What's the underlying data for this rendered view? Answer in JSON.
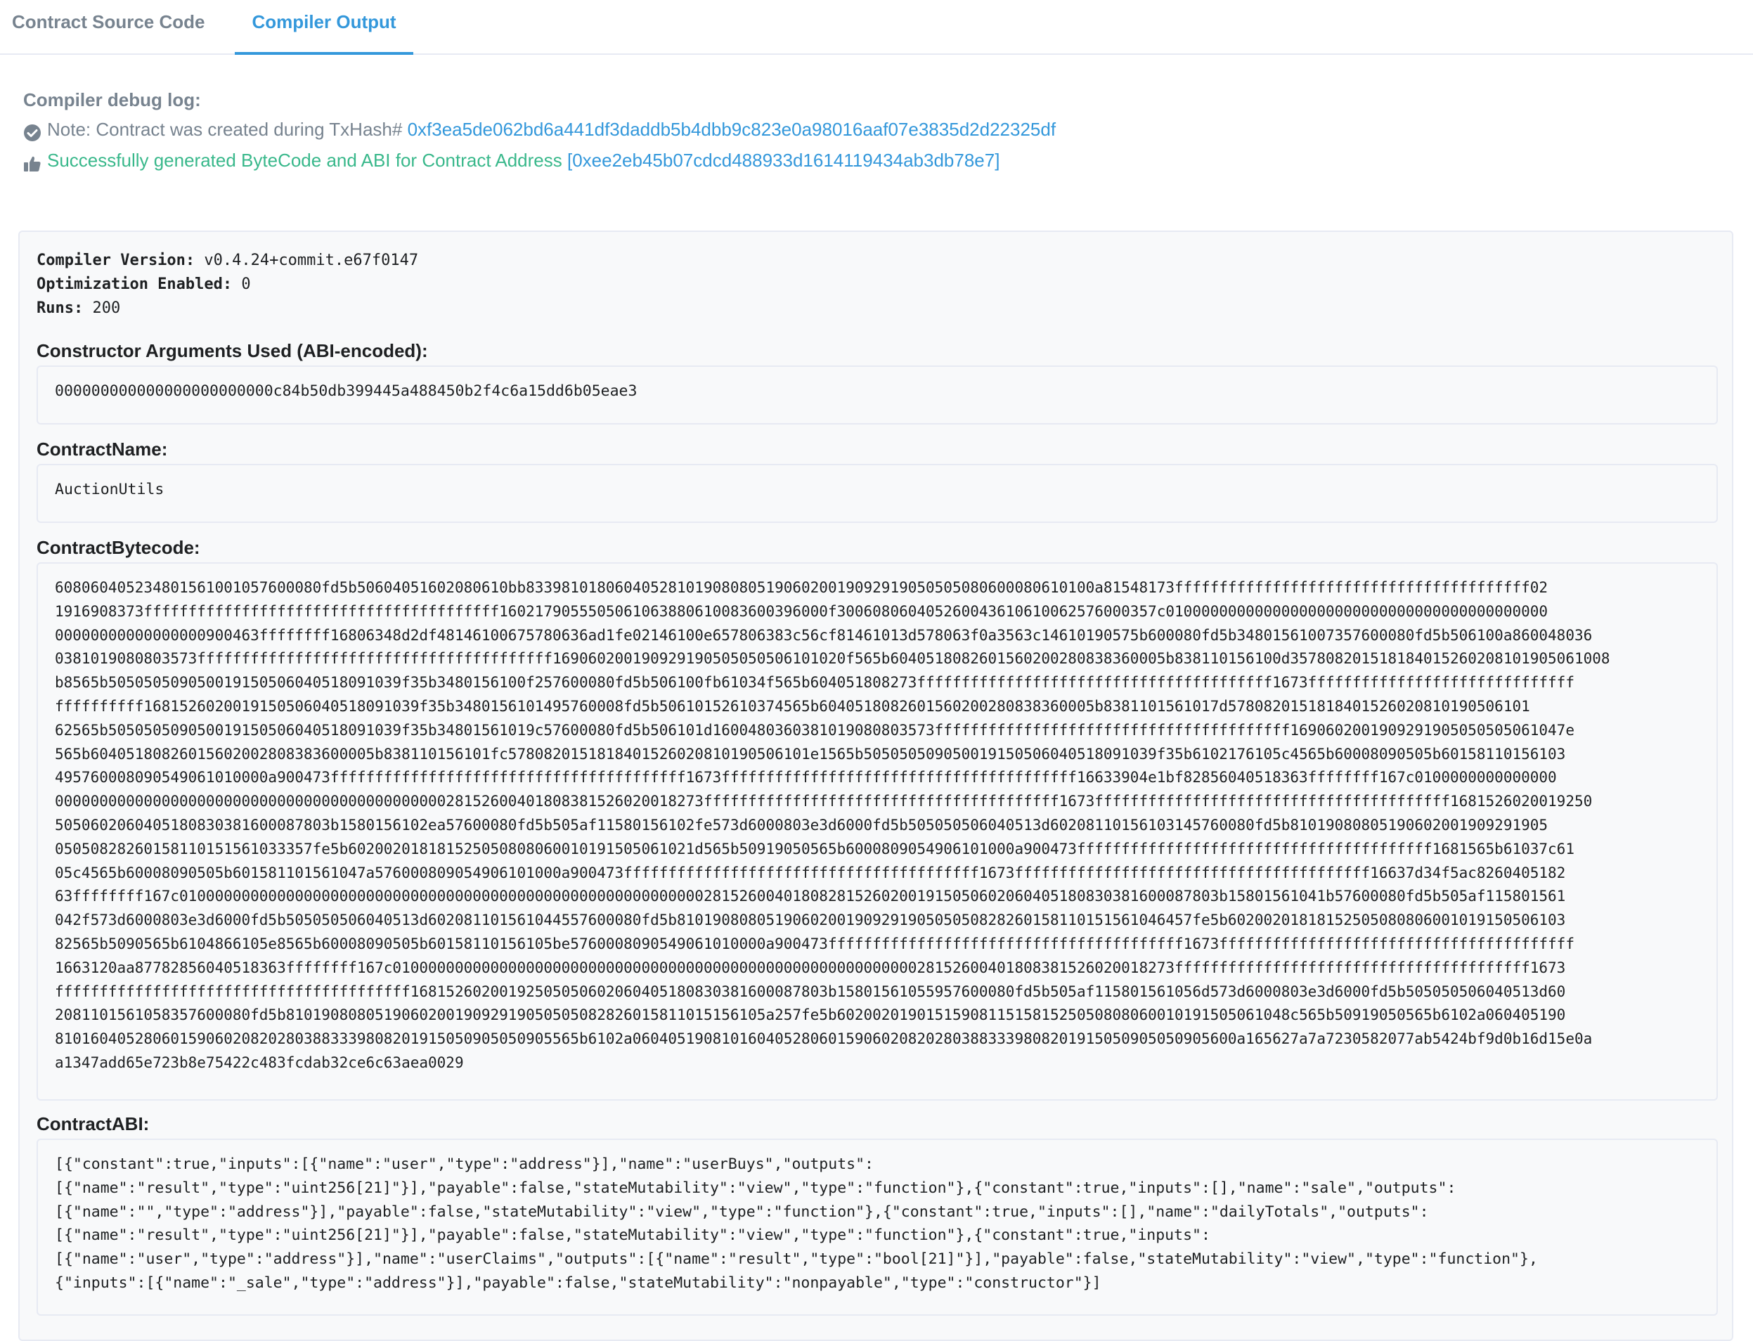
{
  "tabs": [
    {
      "label": "Contract Source Code"
    },
    {
      "label": "Compiler Output"
    }
  ],
  "debug": {
    "heading": "Compiler debug log:",
    "note_label": "Note: Contract was created during TxHash#",
    "tx_hash": "0xf3ea5de062bd6a441df3daddb5b4dbb9c823e0a98016aaf07e3835d2d22325df",
    "success_text": "Successfully generated ByteCode and ABI for Contract Address",
    "contract_address": "[0xee2eb45b07cdcd488933d1614119434ab3db78e7]"
  },
  "compiler": {
    "version_label": "Compiler Version:",
    "version_value": "v0.4.24+commit.e67f0147",
    "optimization_label": "Optimization Enabled:",
    "optimization_value": "0",
    "runs_label": "Runs:",
    "runs_value": "200"
  },
  "sections": {
    "constructor_title": "Constructor Arguments Used (ABI-encoded):",
    "constructor_value": "000000000000000000000000c84b50db399445a488450b2f4c6a15dd6b05eae3",
    "name_title": "ContractName:",
    "name_value": "AuctionUtils",
    "bytecode_title": "ContractBytecode:",
    "bytecode_lines": [
      "608060405234801561001057600080fd5b50604051602080610bb8339810180604052810190808051906020019092919050505080600080610100a81548173ffffffffffffffffffffffffffffffffffffffff02",
      "1916908373ffffffffffffffffffffffffffffffffffffffff1602179055505061063880610083600396000f300608060405260043610610062576000357c0100000000000000000000000000000000000000000",
      "00000000000000000900463ffffffff16806348d2df48146100675780636ad1fe02146100e657806383c56cf81461013d578063f0a3563c14610190575b600080fd5b34801561007357600080fd5b506100a860048036",
      "0381019080803573ffffffffffffffffffffffffffffffffffffffff169060200190929190505050506101020f565b6040518082601560200280838360005b838110156100d357808201518184015260208101905061008",
      "b8565b505050509050019150506040518091039f35b3480156100f257600080fd5b506100fb61034f565b604051808273ffffffffffffffffffffffffffffffffffffffff1673ffffffffffffffffffffffffffffff",
      "ffffffffff1681526020019150506040518091039f35b3480156101495760008fd5b50610152610374565b6040518082601560200280838360005b8381101561017d5780820151818401526020810190506101",
      "62565b505050509050019150506040518091039f35b34801561019c57600080fd5b506101d160048036038101908080357 3ffffffffffffffffffffffffffffffffffffffff1690602001909291905050505061047e",
      "565b60405180826015602002808383600005b838110156101fc578082015181840152602081019050610 1e1565b505050509050019150506040518091039f35b6102176105c4565b60008090505b601581101561 03",
      "495760008090549061010000a900473ffffffffffffffffffffffffffffffffffffffff1673ffffffffffffffffffffffffffffffffffffffff16633904e1bf82856040518363ffffffff167c0100000000000000",
      "0000000000000000000000000000000000000000000028152600401808381526020018273ffffffffffffffffffffffffffffffffffffffff1673ffffffffffffffffffffffffffffffffffffffff1681526020019250",
      "5050602060405180830381600087803b1580156102ea57600080fd5b505af11580156102fe573d6000803e3d6000fd5b505050506040513d60208110156103145760080fd5b81019080805190602001909291905",
      "05050828260158110151561033357fe5b602002018181525050808060010191505061021d565b50919050565b600080905490610100 0a900473ffffffffffffffffffffffffffffffffffffffff1681565b61037c61",
      "05c4565b60008090505b601581101561047a576000809054906101000a900473ffffffffffffffffffffffffffffffffffffffff1673ffffffffffffffffffffffffffffffffffffffff16637d34f5ac8260405182",
      "63ffffffff167c0100000000000000000000000000000000000000000000000000000000028152600401808281526020019150506020604051808303816000 87803b15801561041b57600080fd5b505af115801561",
      "042f573d6000803e3d6000fd5b505050506040513d602081101561044557600080fd5b810190808051906020019092919050505082826015811015156104 6457fe5b602002018181525050808060010191505061 03",
      "82565b5090565b6104866105e8565b60008090505b60158110156105be5760008090549061010000a900473ffffffffffffffffffffffffffffffffffffffff1673ffffffffffffffffffffffffffffffffffffffff",
      "1663120aa87782856040518363ffffffff167c01000000000000000000000000000000000000000000000000000000000281526004018083815260200182 73ffffffffffffffffffffffffffffffffffffffff1673",
      "ffffffffffffffffffffffffffffffffffffffff16815260200192505050602060405180830381600087803b15801561055957600080fd5b505af115801561056d573d6000803e3d6000fd5b505050506040513d60",
      "20811015610583576000 80fd5b810190808051906020019092919050505082826015811015156105a257fe5b602002019015159081151581525050808060010191505061048c565b50919050565b6102a060405190",
      "81016040528060159060208202803883339808201915050905050905565b6102a06040519081016040528060159060208202803883339808201915050905050905600a165627a7a7230582077ab5424bf9d0b16d15e0a",
      "a1347add65e723b8e75422c483fcdab32ce6c63aea0029"
    ],
    "abi_title": "ContractABI:",
    "abi_lines": [
      "[{\"constant\":true,\"inputs\":[{\"name\":\"user\",\"type\":\"address\"}],\"name\":\"userBuys\",\"outputs\":",
      "[{\"name\":\"result\",\"type\":\"uint256[21]\"}],\"payable\":false,\"stateMutability\":\"view\",\"type\":\"function\"},{\"constant\":true,\"inputs\":[],\"name\":\"sale\",\"outputs\":",
      "[{\"name\":\"\",\"type\":\"address\"}],\"payable\":false,\"stateMutability\":\"view\",\"type\":\"function\"},{\"constant\":true,\"inputs\":[],\"name\":\"dailyTotals\",\"outputs\":",
      "[{\"name\":\"result\",\"type\":\"uint256[21]\"}],\"payable\":false,\"stateMutability\":\"view\",\"type\":\"function\"},{\"constant\":true,\"inputs\":",
      "[{\"name\":\"user\",\"type\":\"address\"}],\"name\":\"userClaims\",\"outputs\":[{\"name\":\"result\",\"type\":\"bool[21]\"}],\"payable\":false,\"stateMutability\":\"view\",\"type\":\"function\"},",
      "{\"inputs\":[{\"name\":\"_sale\",\"type\":\"address\"}],\"payable\":false,\"stateMutability\":\"nonpayable\",\"type\":\"constructor\"}]"
    ]
  },
  "icons": {
    "note": "check-circle-icon",
    "success": "thumbs-up-icon"
  },
  "colors": {
    "link": "#3498db",
    "success": "#39b88b",
    "muted": "#77838f",
    "panel_bg": "#f8f9fa",
    "border": "#e7eaf3"
  }
}
